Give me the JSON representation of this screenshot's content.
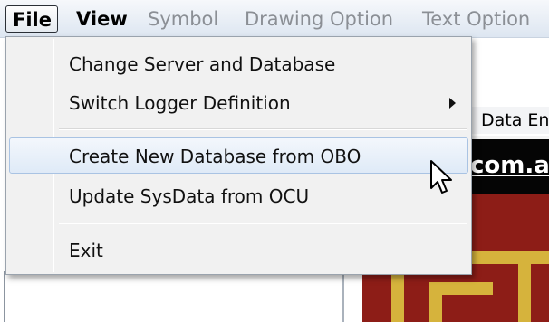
{
  "menubar": {
    "file": "File",
    "view": "View",
    "symbol": "Symbol",
    "drawing_option": "Drawing Option",
    "text_option": "Text Option"
  },
  "file_menu": {
    "items": [
      {
        "label": "Change Server and Database"
      },
      {
        "label": "Switch Logger Definition",
        "submenu": true
      },
      {
        "label": "Create New Database from OBO",
        "highlighted": true
      },
      {
        "label": "Update SysData from OCU"
      },
      {
        "label": "Exit"
      }
    ]
  },
  "background": {
    "tab_label": "Data En",
    "banner_text": "com.au"
  },
  "colors": {
    "menu_bg": "#f1f1f1",
    "highlight": "#dfeaf7",
    "banner_red": "#8d1d17",
    "banner_gold": "#d6b33c"
  }
}
